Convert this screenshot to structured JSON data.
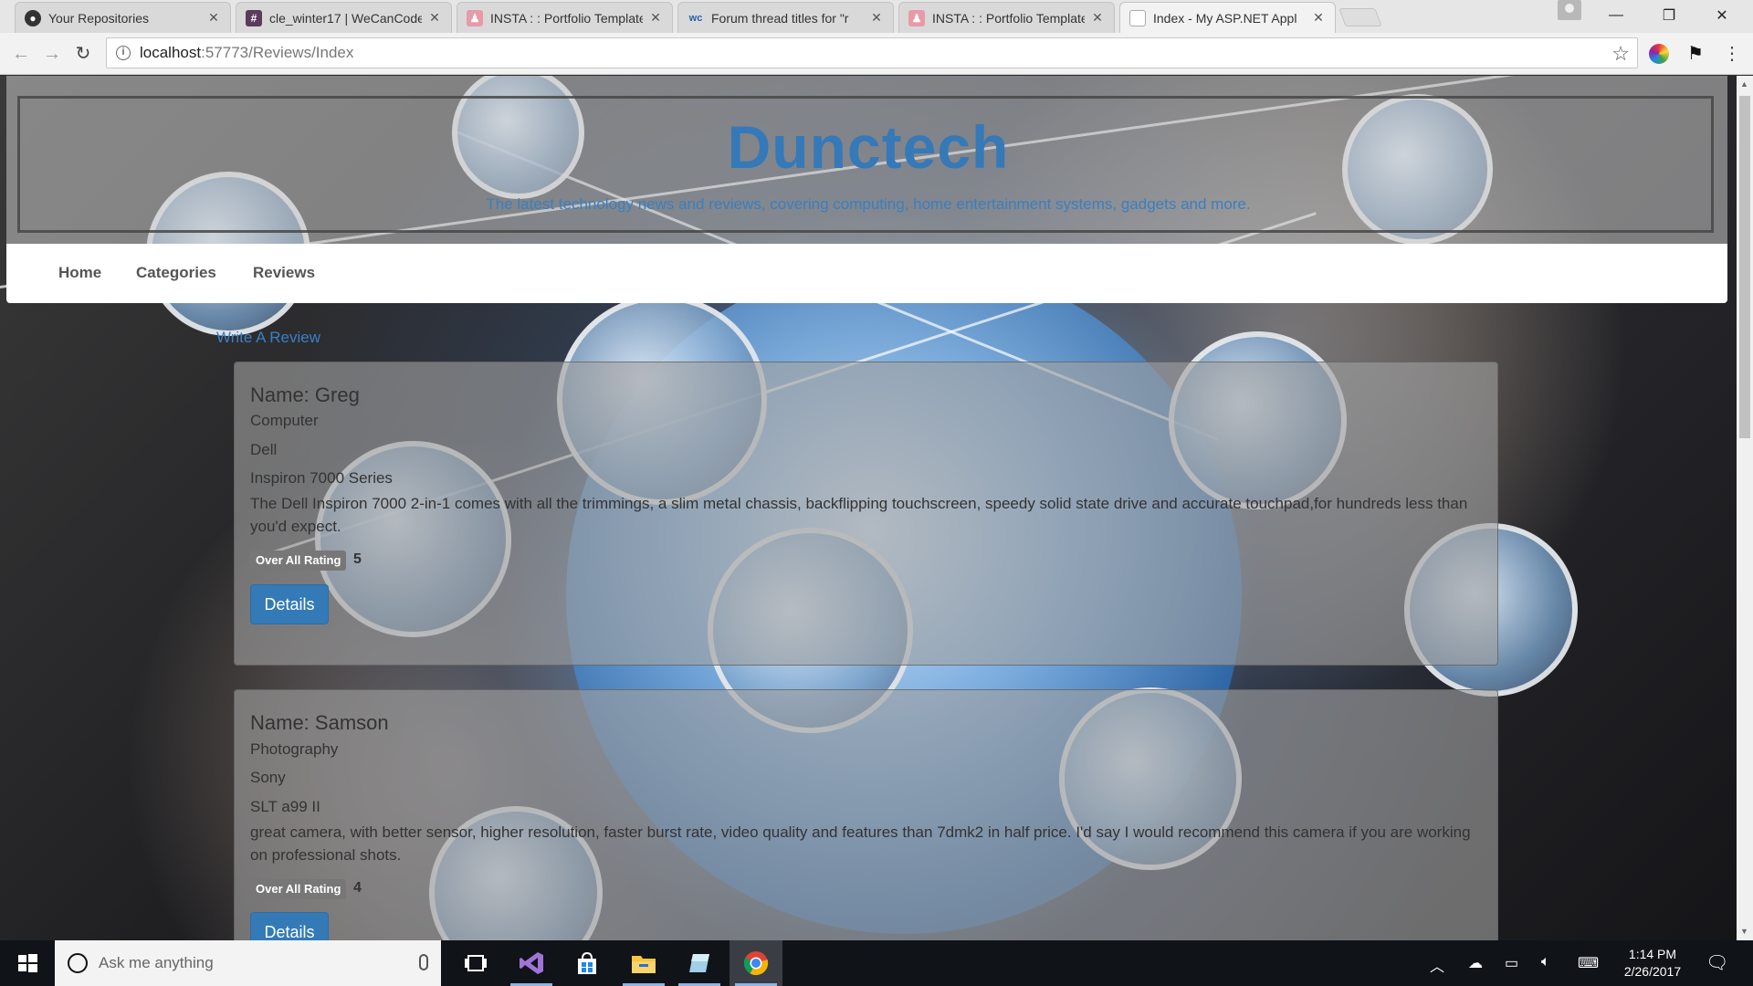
{
  "browser": {
    "tabs": [
      {
        "title": "Your Repositories",
        "icon": "github-icon",
        "active": false
      },
      {
        "title": "cle_winter17 | WeCanCode",
        "icon": "slack-icon",
        "active": false
      },
      {
        "title": "INSTA : : Portfolio Template",
        "icon": "person-icon",
        "active": false
      },
      {
        "title": "Forum thread titles for \"r",
        "icon": "wc-icon",
        "active": false
      },
      {
        "title": "INSTA : : Portfolio Template",
        "icon": "person-icon",
        "active": false
      },
      {
        "title": "Index - My ASP.NET Appl",
        "icon": "page-icon",
        "active": true
      }
    ],
    "url_host": "localhost",
    "url_rest": ":57773/Reviews/Index"
  },
  "site": {
    "title": "Dunctech",
    "tagline": "The latest technology news and reviews, covering computing, home entertainment systems, gadgets and more.",
    "nav": [
      "Home",
      "Categories",
      "Reviews"
    ],
    "write_review": "Write A Review"
  },
  "reviews": [
    {
      "name": "Name: Greg",
      "category": "Computer",
      "brand": "Dell",
      "model": "Inspiron 7000 Series",
      "description": "The Dell Inspiron 7000 2-in-1 comes with all the trimmings, a slim metal chassis, backflipping touchscreen, speedy solid state drive and accurate touchpad,for hundreds less than you'd expect.",
      "rating_label": "Over All Rating",
      "rating": "5",
      "details_label": "Details"
    },
    {
      "name": "Name: Samson",
      "category": "Photography",
      "brand": "Sony",
      "model": "SLT a99 II",
      "description": "great camera, with better sensor, higher resolution, faster burst rate, video quality and features than 7dmk2 in half price. I'd say I would recommend this camera if you are working on professional shots.",
      "rating_label": "Over All Rating",
      "rating": "4",
      "details_label": "Details"
    }
  ],
  "taskbar": {
    "search_placeholder": "Ask me anything",
    "time": "1:14 PM",
    "date": "2/26/2017"
  },
  "colors": {
    "brand_blue": "#3579b8",
    "button_blue": "#337ab7"
  }
}
